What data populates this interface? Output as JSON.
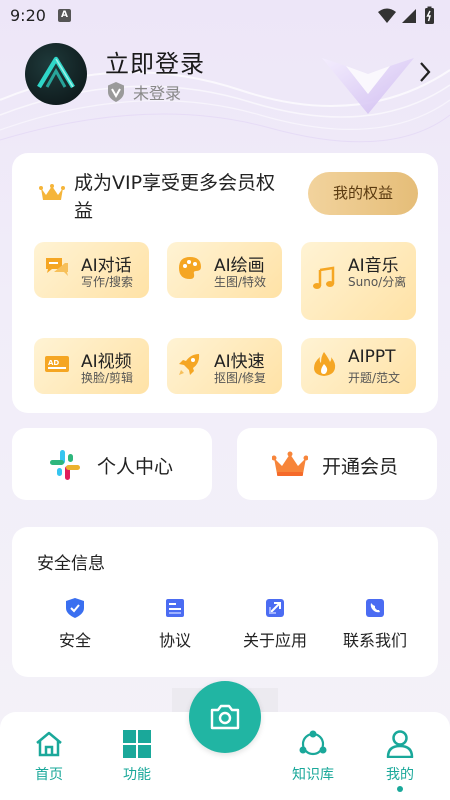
{
  "status_bar": {
    "time": "9:20",
    "notification_letter": "A"
  },
  "profile": {
    "title": "立即登录",
    "status": "未登录",
    "chevron_icon": "chevron-right-icon",
    "badge_icon": "verified-badge-icon"
  },
  "vip": {
    "title": "成为VIP享受更多会员权益",
    "rights_button": "我的权益",
    "crown_icon": "crown-icon",
    "features": [
      {
        "name": "AI对话",
        "sub": "写作/搜索",
        "icon": "chat-icon"
      },
      {
        "name": "AI绘画",
        "sub": "生图/特效",
        "icon": "palette-icon"
      },
      {
        "name": "AI音乐",
        "sub": "Suno/分离",
        "icon": "music-note-icon"
      },
      {
        "name": "AI视频",
        "sub": "换脸/剪辑",
        "icon": "video-ad-icon"
      },
      {
        "name": "AI快速",
        "sub": "抠图/修复",
        "icon": "rocket-icon"
      },
      {
        "name": "AIPPT",
        "sub": "开题/范文",
        "icon": "flame-icon"
      }
    ]
  },
  "quick_actions": [
    {
      "label": "个人中心",
      "icon": "grid-hash-icon"
    },
    {
      "label": "开通会员",
      "icon": "crown-icon"
    }
  ],
  "security": {
    "title": "安全信息",
    "items": [
      {
        "label": "安全",
        "icon": "shield-check-icon"
      },
      {
        "label": "协议",
        "icon": "document-icon"
      },
      {
        "label": "关于应用",
        "icon": "share-link-icon"
      },
      {
        "label": "联系我们",
        "icon": "phone-icon"
      }
    ]
  },
  "bottom_nav": {
    "items": [
      {
        "label": "首页",
        "icon": "home-icon"
      },
      {
        "label": "功能",
        "icon": "grid-icon"
      },
      {
        "label": "知识库",
        "icon": "network-icon"
      },
      {
        "label": "我的",
        "icon": "person-icon"
      }
    ],
    "center_icon": "camera-icon",
    "active_color": "#1aa89a"
  },
  "colors": {
    "accent": "#21b5a3",
    "gold_button": "#e9c585",
    "feature_bg": "#ffe8b5"
  }
}
